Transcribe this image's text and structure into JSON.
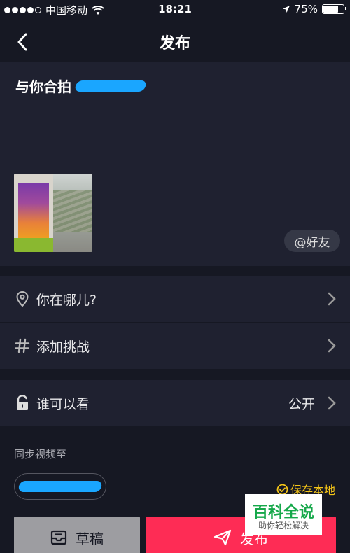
{
  "status": {
    "carrier": "中国移动",
    "time": "18:21",
    "battery": "75%",
    "battery_level": 0.75
  },
  "nav": {
    "title": "发布"
  },
  "post": {
    "caption": "与你合拍",
    "at_friend": "@好友"
  },
  "rows": {
    "location": "你在哪儿?",
    "challenge": "添加挑战",
    "visibility": "谁可以看",
    "visibility_value": "公开"
  },
  "sync": {
    "label": "同步视频至",
    "save_local": "保存本地"
  },
  "actions": {
    "draft": "草稿",
    "publish": "发布"
  },
  "watermark": {
    "line1": "百科全说",
    "line2": "助你轻松解决"
  },
  "colors": {
    "background": "#161823",
    "panel": "#1f2130",
    "accent_red": "#fe2c55",
    "accent_yellow": "#f5c518",
    "draft_gray": "#9d9da1"
  },
  "icons": [
    "back-arrow-icon",
    "location-pin-icon",
    "hashtag-icon",
    "unlock-icon",
    "chevron-right-icon",
    "check-circle-icon",
    "draft-box-icon",
    "send-icon",
    "wifi-icon",
    "location-arrow-icon"
  ]
}
